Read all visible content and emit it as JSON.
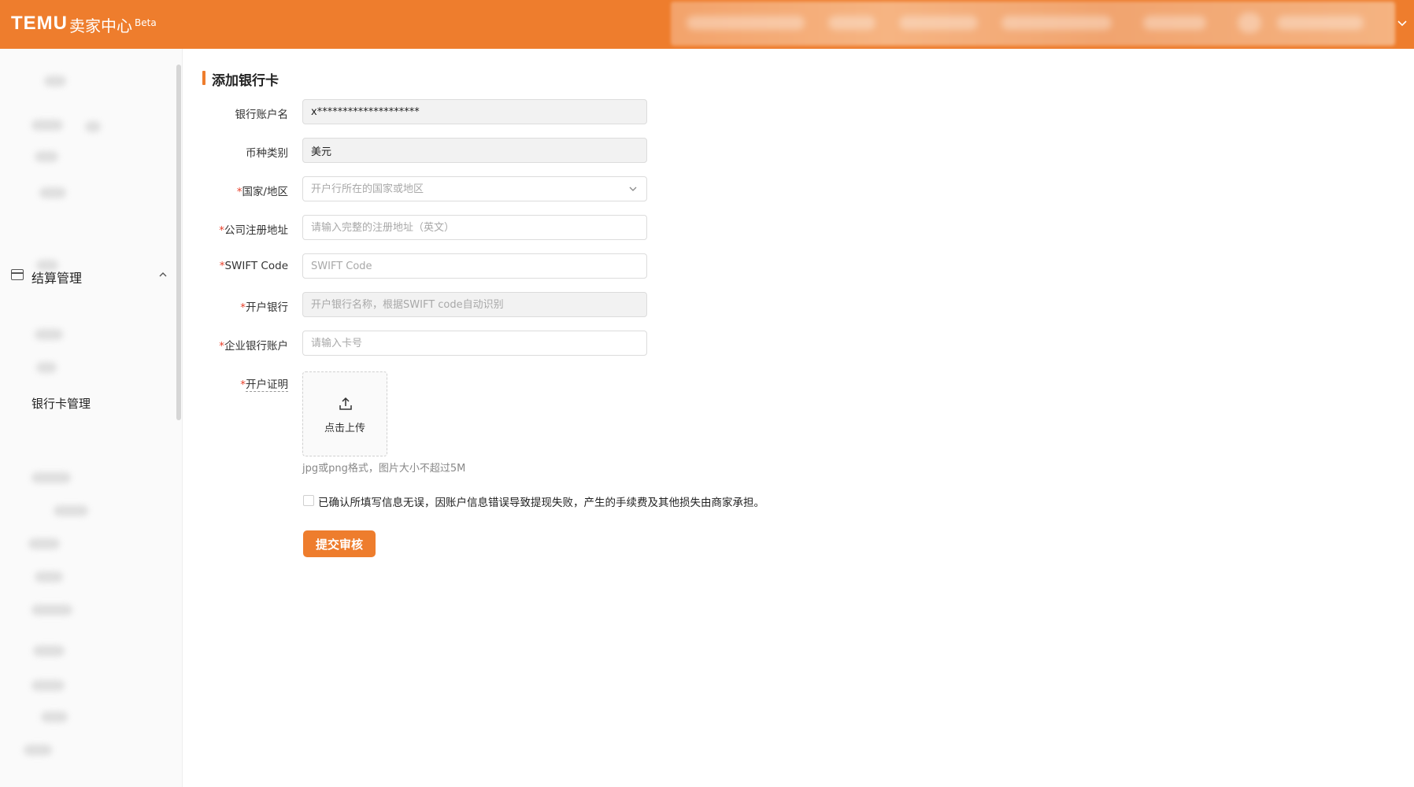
{
  "header": {
    "logo": "TEMU",
    "title": "卖家中心",
    "badge": "Beta"
  },
  "sidebar": {
    "group_label": "结算管理",
    "active_item": "银行卡管理"
  },
  "page": {
    "title": "添加银行卡"
  },
  "form": {
    "account_name": {
      "label": "银行账户名",
      "value": "x********************",
      "required": false
    },
    "currency": {
      "label": "币种类别",
      "value": "美元",
      "required": false
    },
    "country": {
      "label": "国家/地区",
      "placeholder": "开户行所在的国家或地区",
      "required": true
    },
    "address": {
      "label": "公司注册地址",
      "placeholder": "请输入完整的注册地址（英文）",
      "required": true
    },
    "swift": {
      "label": "SWIFT Code",
      "placeholder": "SWIFT Code",
      "required": true
    },
    "bank": {
      "label": "开户银行",
      "placeholder": "开户银行名称，根据SWIFT code自动识别",
      "required": true
    },
    "account_no": {
      "label": "企业银行账户",
      "placeholder": "请输入卡号",
      "required": true
    },
    "certificate": {
      "label": "开户证明",
      "upload_text": "点击上传",
      "hint": "jpg或png格式，图片大小不超过5M",
      "required": true
    },
    "confirm_text": "已确认所填写信息无误，因账户信息错误导致提现失败，产生的手续费及其他损失由商家承担。",
    "submit_label": "提交审核"
  },
  "colors": {
    "brand": "#ee7d2d",
    "required": "#e8412c"
  }
}
